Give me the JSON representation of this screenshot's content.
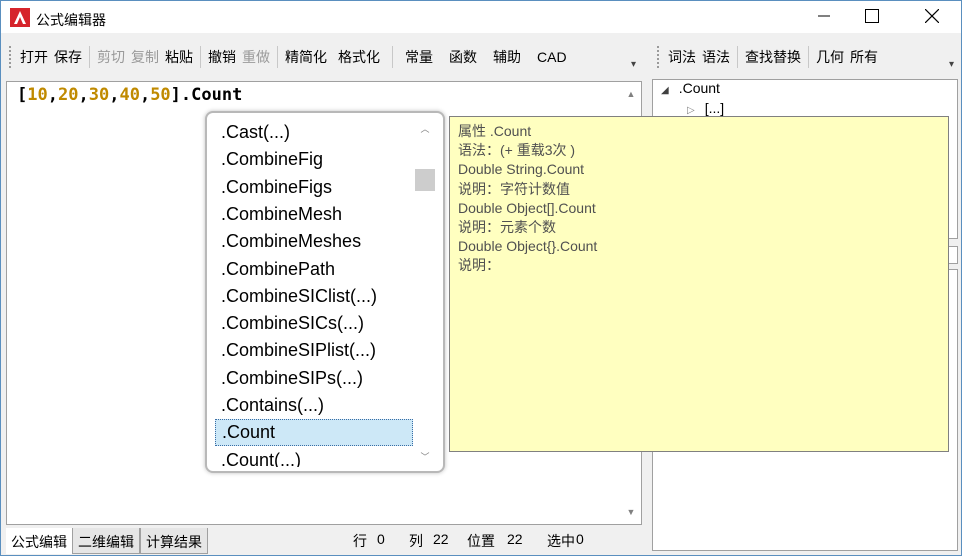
{
  "window": {
    "title": "公式编辑器"
  },
  "toolbar_left": [
    {
      "label": "打开",
      "disabled": false
    },
    {
      "label": "保存",
      "disabled": false
    },
    {
      "sep": true
    },
    {
      "label": "剪切",
      "disabled": true
    },
    {
      "label": "复制",
      "disabled": true
    },
    {
      "label": "粘贴",
      "disabled": false
    },
    {
      "sep": true
    },
    {
      "label": "撤销",
      "disabled": false
    },
    {
      "label": "重做",
      "disabled": true
    },
    {
      "sep": true
    },
    {
      "label": "精简化",
      "disabled": false
    },
    {
      "label": "格式化",
      "disabled": false
    },
    {
      "sep": true
    },
    {
      "label": "常量",
      "disabled": false
    },
    {
      "label": "函数",
      "disabled": false
    },
    {
      "label": "辅助",
      "disabled": false
    },
    {
      "label": "CAD",
      "disabled": false
    }
  ],
  "toolbar_right": [
    {
      "label": "词法",
      "disabled": false
    },
    {
      "label": "语法",
      "disabled": false
    },
    {
      "sep": true
    },
    {
      "label": "查找替换",
      "disabled": false
    },
    {
      "sep": true
    },
    {
      "label": "几何",
      "disabled": false
    },
    {
      "label": "所有",
      "disabled": false
    }
  ],
  "editor": {
    "tokens": [
      {
        "t": "[",
        "c": "c-br"
      },
      {
        "t": "10",
        "c": "c-num"
      },
      {
        "t": ",",
        "c": "c-br"
      },
      {
        "t": "20",
        "c": "c-num"
      },
      {
        "t": ",",
        "c": "c-br"
      },
      {
        "t": "30",
        "c": "c-num"
      },
      {
        "t": ",",
        "c": "c-br"
      },
      {
        "t": "40",
        "c": "c-num"
      },
      {
        "t": ",",
        "c": "c-br"
      },
      {
        "t": "50",
        "c": "c-num"
      },
      {
        "t": "].Count",
        "c": "c-br"
      }
    ]
  },
  "autocomplete": {
    "items": [
      ".Cast(...)",
      ".CombineFig",
      ".CombineFigs",
      ".CombineMesh",
      ".CombineMeshes",
      ".CombinePath",
      ".CombineSIClist(...)",
      ".CombineSICs(...)",
      ".CombineSIPlist(...)",
      ".CombineSIPs(...)",
      ".Contains(...)",
      ".Count",
      ".Count(...)"
    ],
    "selected_index": 11
  },
  "tooltip": {
    "lines": [
      "属性 .Count",
      "语法：(+ 重载3次 )",
      "Double String.Count",
      "说明：字符计数值",
      "Double Object[].Count",
      "说明：元素个数",
      "Double Object{}.Count",
      "说明："
    ]
  },
  "tree": {
    "root": ".Count",
    "child": "[...]"
  },
  "tabs": [
    {
      "label": "公式编辑",
      "active": true
    },
    {
      "label": "二维编辑",
      "active": false
    },
    {
      "label": "计算结果",
      "active": false
    }
  ],
  "status": {
    "row_label": "行",
    "row_value": "0",
    "col_label": "列",
    "col_value": "22",
    "pos_label": "位置",
    "pos_value": "22",
    "sel_label": "选中",
    "sel_value": "0"
  }
}
